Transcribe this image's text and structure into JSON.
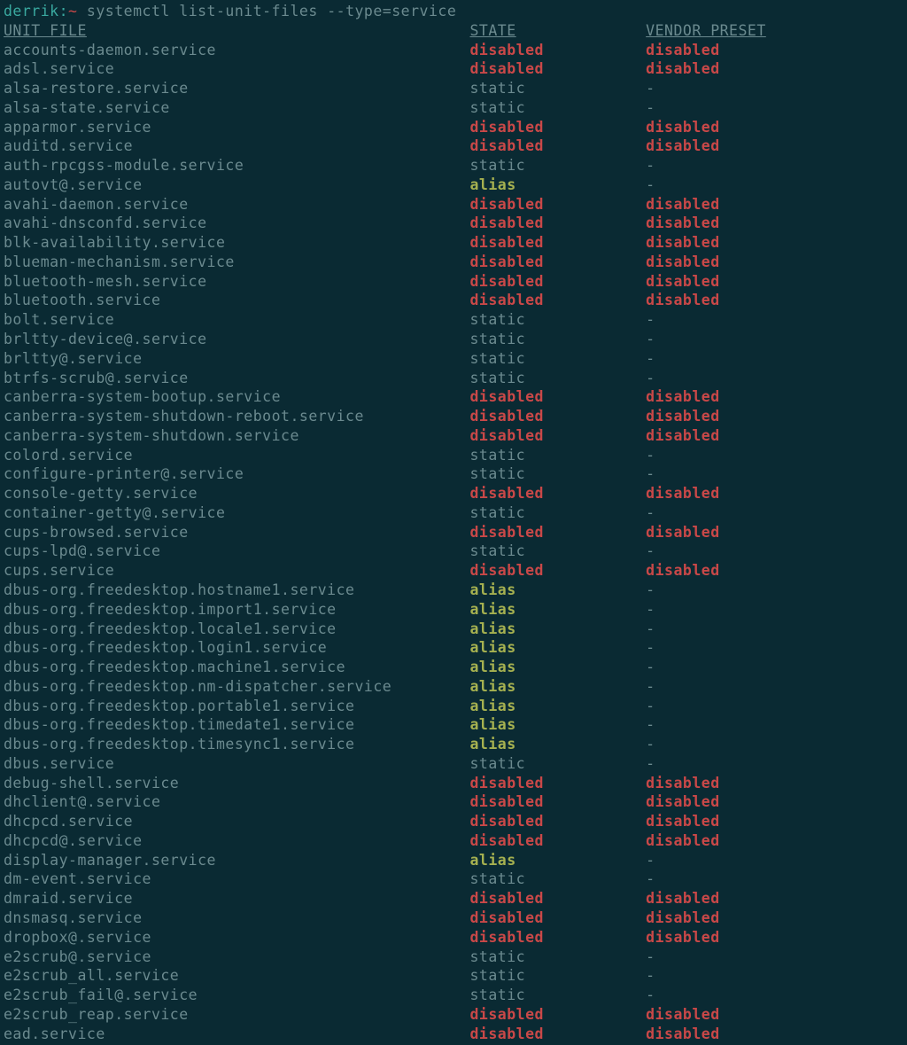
{
  "prompt": {
    "user_host": "derrik:",
    "tilde": "~",
    "command": " systemctl list-unit-files --type=service"
  },
  "headers": {
    "unit": "UNIT FILE",
    "state": "STATE",
    "preset": "VENDOR PRESET"
  },
  "rows": [
    {
      "unit": "accounts-daemon.service",
      "state": "disabled",
      "preset": "disabled"
    },
    {
      "unit": "adsl.service",
      "state": "disabled",
      "preset": "disabled"
    },
    {
      "unit": "alsa-restore.service",
      "state": "static",
      "preset": "-"
    },
    {
      "unit": "alsa-state.service",
      "state": "static",
      "preset": "-"
    },
    {
      "unit": "apparmor.service",
      "state": "disabled",
      "preset": "disabled"
    },
    {
      "unit": "auditd.service",
      "state": "disabled",
      "preset": "disabled"
    },
    {
      "unit": "auth-rpcgss-module.service",
      "state": "static",
      "preset": "-"
    },
    {
      "unit": "autovt@.service",
      "state": "alias",
      "preset": "-"
    },
    {
      "unit": "avahi-daemon.service",
      "state": "disabled",
      "preset": "disabled"
    },
    {
      "unit": "avahi-dnsconfd.service",
      "state": "disabled",
      "preset": "disabled"
    },
    {
      "unit": "blk-availability.service",
      "state": "disabled",
      "preset": "disabled"
    },
    {
      "unit": "blueman-mechanism.service",
      "state": "disabled",
      "preset": "disabled"
    },
    {
      "unit": "bluetooth-mesh.service",
      "state": "disabled",
      "preset": "disabled"
    },
    {
      "unit": "bluetooth.service",
      "state": "disabled",
      "preset": "disabled"
    },
    {
      "unit": "bolt.service",
      "state": "static",
      "preset": "-"
    },
    {
      "unit": "brltty-device@.service",
      "state": "static",
      "preset": "-"
    },
    {
      "unit": "brltty@.service",
      "state": "static",
      "preset": "-"
    },
    {
      "unit": "btrfs-scrub@.service",
      "state": "static",
      "preset": "-"
    },
    {
      "unit": "canberra-system-bootup.service",
      "state": "disabled",
      "preset": "disabled"
    },
    {
      "unit": "canberra-system-shutdown-reboot.service",
      "state": "disabled",
      "preset": "disabled"
    },
    {
      "unit": "canberra-system-shutdown.service",
      "state": "disabled",
      "preset": "disabled"
    },
    {
      "unit": "colord.service",
      "state": "static",
      "preset": "-"
    },
    {
      "unit": "configure-printer@.service",
      "state": "static",
      "preset": "-"
    },
    {
      "unit": "console-getty.service",
      "state": "disabled",
      "preset": "disabled"
    },
    {
      "unit": "container-getty@.service",
      "state": "static",
      "preset": "-"
    },
    {
      "unit": "cups-browsed.service",
      "state": "disabled",
      "preset": "disabled"
    },
    {
      "unit": "cups-lpd@.service",
      "state": "static",
      "preset": "-"
    },
    {
      "unit": "cups.service",
      "state": "disabled",
      "preset": "disabled"
    },
    {
      "unit": "dbus-org.freedesktop.hostname1.service",
      "state": "alias",
      "preset": "-"
    },
    {
      "unit": "dbus-org.freedesktop.import1.service",
      "state": "alias",
      "preset": "-"
    },
    {
      "unit": "dbus-org.freedesktop.locale1.service",
      "state": "alias",
      "preset": "-"
    },
    {
      "unit": "dbus-org.freedesktop.login1.service",
      "state": "alias",
      "preset": "-"
    },
    {
      "unit": "dbus-org.freedesktop.machine1.service",
      "state": "alias",
      "preset": "-"
    },
    {
      "unit": "dbus-org.freedesktop.nm-dispatcher.service",
      "state": "alias",
      "preset": "-"
    },
    {
      "unit": "dbus-org.freedesktop.portable1.service",
      "state": "alias",
      "preset": "-"
    },
    {
      "unit": "dbus-org.freedesktop.timedate1.service",
      "state": "alias",
      "preset": "-"
    },
    {
      "unit": "dbus-org.freedesktop.timesync1.service",
      "state": "alias",
      "preset": "-"
    },
    {
      "unit": "dbus.service",
      "state": "static",
      "preset": "-"
    },
    {
      "unit": "debug-shell.service",
      "state": "disabled",
      "preset": "disabled"
    },
    {
      "unit": "dhclient@.service",
      "state": "disabled",
      "preset": "disabled"
    },
    {
      "unit": "dhcpcd.service",
      "state": "disabled",
      "preset": "disabled"
    },
    {
      "unit": "dhcpcd@.service",
      "state": "disabled",
      "preset": "disabled"
    },
    {
      "unit": "display-manager.service",
      "state": "alias",
      "preset": "-"
    },
    {
      "unit": "dm-event.service",
      "state": "static",
      "preset": "-"
    },
    {
      "unit": "dmraid.service",
      "state": "disabled",
      "preset": "disabled"
    },
    {
      "unit": "dnsmasq.service",
      "state": "disabled",
      "preset": "disabled"
    },
    {
      "unit": "dropbox@.service",
      "state": "disabled",
      "preset": "disabled"
    },
    {
      "unit": "e2scrub@.service",
      "state": "static",
      "preset": "-"
    },
    {
      "unit": "e2scrub_all.service",
      "state": "static",
      "preset": "-"
    },
    {
      "unit": "e2scrub_fail@.service",
      "state": "static",
      "preset": "-"
    },
    {
      "unit": "e2scrub_reap.service",
      "state": "disabled",
      "preset": "disabled"
    },
    {
      "unit": "ead.service",
      "state": "disabled",
      "preset": "disabled"
    }
  ]
}
